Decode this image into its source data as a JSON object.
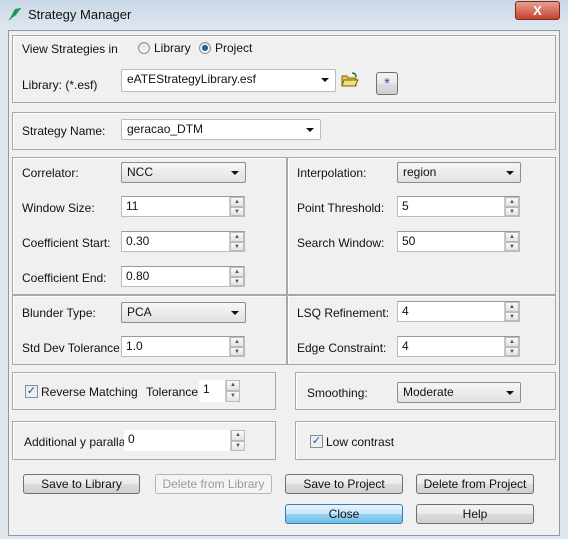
{
  "window": {
    "title": "Strategy Manager",
    "close_glyph": "X"
  },
  "view": {
    "label": "View Strategies in",
    "options": [
      {
        "label": "Library",
        "selected": false
      },
      {
        "label": "Project",
        "selected": true
      }
    ]
  },
  "library": {
    "label": "Library: (*.esf)",
    "value": "eATEStrategyLibrary.esf",
    "new_glyph": "*"
  },
  "strategy": {
    "label": "Strategy Name:",
    "value": "geracao_DTM"
  },
  "params": {
    "correlator": {
      "label": "Correlator:",
      "value": "NCC"
    },
    "window_size": {
      "label": "Window Size:",
      "value": "11"
    },
    "coef_start": {
      "label": "Coefficient Start:",
      "value": "0.30"
    },
    "coef_end": {
      "label": "Coefficient End:",
      "value": "0.80"
    },
    "interpolation": {
      "label": "Interpolation:",
      "value": "region"
    },
    "point_threshold": {
      "label": "Point Threshold:",
      "value": "5"
    },
    "search_window": {
      "label": "Search Window:",
      "value": "50"
    },
    "blunder": {
      "label": "Blunder Type:",
      "value": "PCA"
    },
    "std_dev": {
      "label": "Std Dev Tolerance:",
      "value": "1.0"
    },
    "lsq": {
      "label": "LSQ Refinement:",
      "value": "4"
    },
    "edge": {
      "label": "Edge Constraint:",
      "value": "4"
    }
  },
  "reverse": {
    "label": "Reverse Matching",
    "checked": true,
    "tolerance_label": "Tolerance:",
    "tolerance": "1"
  },
  "smoothing": {
    "label": "Smoothing:",
    "value": "Moderate"
  },
  "parallax": {
    "label": "Additional y parallax:",
    "value": "0"
  },
  "low_contrast": {
    "label": "Low contrast",
    "checked": true
  },
  "buttons": {
    "save_library": "Save to Library",
    "delete_library": "Delete from Library",
    "save_project": "Save to Project",
    "delete_project": "Delete from Project",
    "close": "Close",
    "help": "Help"
  }
}
